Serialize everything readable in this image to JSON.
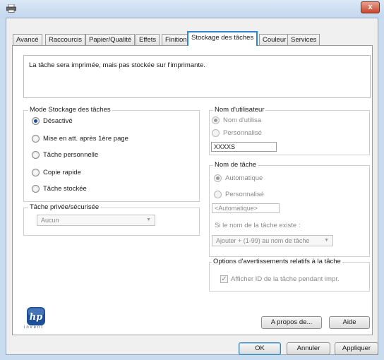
{
  "tabs": [
    {
      "label": "Avancé"
    },
    {
      "label": "Raccourcis"
    },
    {
      "label": "Papier/Qualité"
    },
    {
      "label": "Effets"
    },
    {
      "label": "Finition"
    },
    {
      "label": "Stockage des tâches",
      "active": true
    },
    {
      "label": "Couleur"
    },
    {
      "label": "Services"
    }
  ],
  "message": "La tâche sera imprimée, mais pas stockée sur l'imprimante.",
  "mode_group": {
    "legend": "Mode Stockage des tâches",
    "options": [
      {
        "label": "Désactivé",
        "checked": true
      },
      {
        "label": "Mise en att. après 1ère page",
        "checked": false
      },
      {
        "label": "Tâche personnelle",
        "checked": false
      },
      {
        "label": "Copie rapide",
        "checked": false
      },
      {
        "label": "Tâche stockée",
        "checked": false
      }
    ]
  },
  "private_group": {
    "legend": "Tâche privée/sécurisée",
    "select_value": "Aucun"
  },
  "user_group": {
    "legend": "Nom d'utilisateur",
    "options": [
      {
        "label": "Nom d'utilisa",
        "checked": true
      },
      {
        "label": "Personnalisé",
        "checked": false
      }
    ],
    "input_value": "XXXXS"
  },
  "job_group": {
    "legend": "Nom de tâche",
    "options": [
      {
        "label": "Automatique",
        "checked": true
      },
      {
        "label": "Personnalisé",
        "checked": false
      }
    ],
    "input_value": "<Automatique>",
    "exists_label": "Si le nom de la tâche existe :",
    "exists_select": "Ajouter + (1-99) au nom de tâche"
  },
  "alerts_group": {
    "legend": "Options d'avertissements relatifs à la tâche",
    "checkbox_label": "Afficher ID de la tâche pendant impr.",
    "checkbox_checked": true
  },
  "logo_text": "invent",
  "buttons": {
    "about": "A propos de...",
    "help": "Aide",
    "ok": "OK",
    "cancel": "Annuler",
    "apply": "Appliquer"
  },
  "title_close": "x"
}
